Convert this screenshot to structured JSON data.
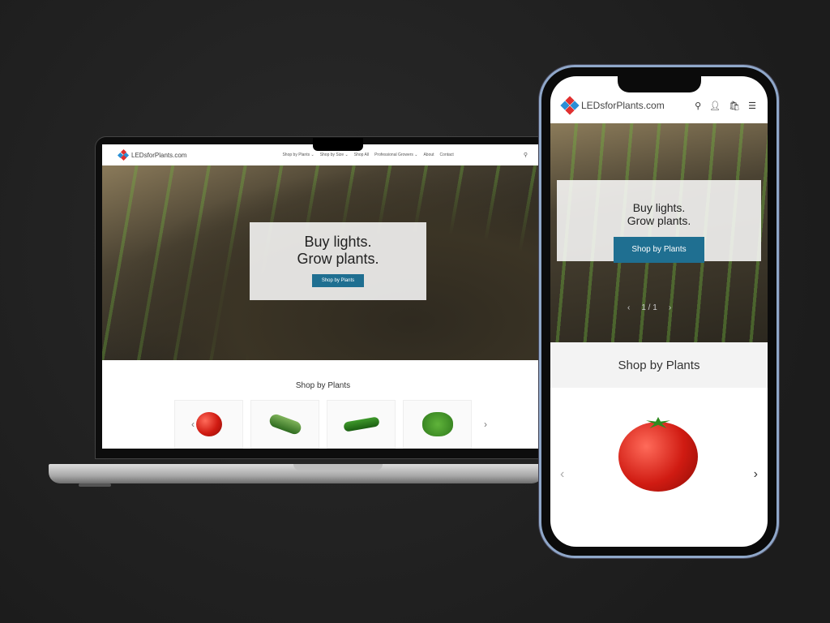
{
  "brand": {
    "logo_text": "LEDsforPlants.com",
    "accent": "#1f6f91"
  },
  "desktop": {
    "nav": [
      "Shop by Plants ⌄",
      "Shop by Size ⌄",
      "Shop All",
      "Professional Growers ⌄",
      "About",
      "Contact"
    ],
    "hero": {
      "line1": "Buy lights.",
      "line2": "Grow plants.",
      "button": "Shop by Plants"
    },
    "section_title": "Shop by Plants",
    "products": [
      {
        "icon": "tomato-icon"
      },
      {
        "icon": "cucumber-icon"
      },
      {
        "icon": "pepper-icon"
      },
      {
        "icon": "lettuce-icon"
      }
    ]
  },
  "mobile": {
    "hero": {
      "line1": "Buy lights.",
      "line2": "Grow plants.",
      "button": "Shop by Plants",
      "slide_counter": "1 / 1"
    },
    "section_title": "Shop by Plants",
    "icons": [
      "search-icon",
      "account-icon",
      "cart-icon",
      "menu-icon"
    ]
  }
}
